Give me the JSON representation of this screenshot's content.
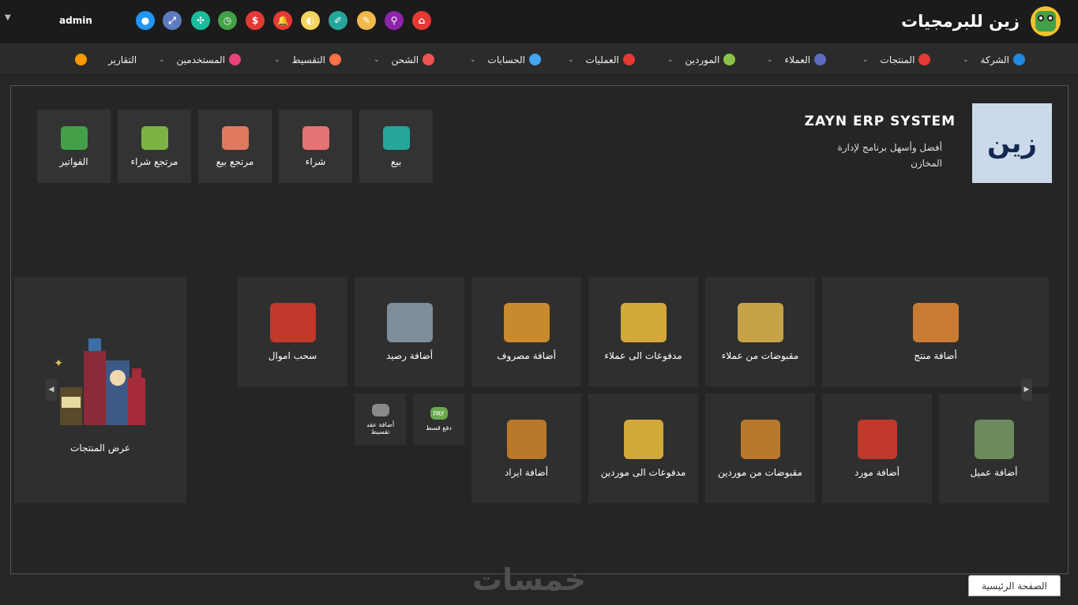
{
  "header": {
    "brand_name": "زين للبرمجيات",
    "user_name": "admin",
    "toolbar_icons": [
      {
        "name": "home-icon",
        "glyph": "⌂",
        "color": "#e53935"
      },
      {
        "name": "search-icon",
        "glyph": "⚲",
        "color": "#8e24aa"
      },
      {
        "name": "notes-icon",
        "glyph": "✎",
        "color": "#f0b94a"
      },
      {
        "name": "edit-icon",
        "glyph": "✐",
        "color": "#26a69a"
      },
      {
        "name": "theme-icon",
        "glyph": "◐",
        "color": "#f4d35e"
      },
      {
        "name": "bell-icon",
        "glyph": "🔔",
        "color": "#e53935"
      },
      {
        "name": "dollar-icon",
        "glyph": "$",
        "color": "#e53935"
      },
      {
        "name": "clock-icon",
        "glyph": "◷",
        "color": "#43a047"
      },
      {
        "name": "compress-icon",
        "glyph": "✣",
        "color": "#1abc9c"
      },
      {
        "name": "expand-icon",
        "glyph": "⤢",
        "color": "#5c7cbf"
      },
      {
        "name": "user-icon",
        "glyph": "●",
        "color": "#2196f3"
      }
    ]
  },
  "menu": {
    "items": [
      {
        "label": "الشركة",
        "icon": "company-icon",
        "color": "#1e88e5"
      },
      {
        "label": "المنتجات",
        "icon": "products-icon",
        "color": "#e53935"
      },
      {
        "label": "العملاء",
        "icon": "customers-icon",
        "color": "#5c6bc0"
      },
      {
        "label": "الموردين",
        "icon": "suppliers-icon",
        "color": "#8bc34a"
      },
      {
        "label": "العمليات",
        "icon": "operations-icon",
        "color": "#e53935"
      },
      {
        "label": "الحسابات",
        "icon": "accounts-icon",
        "color": "#42a5f5"
      },
      {
        "label": "الشحن",
        "icon": "shipping-icon",
        "color": "#ef5350"
      },
      {
        "label": "التقسيط",
        "icon": "installments-icon",
        "color": "#ff7043"
      },
      {
        "label": "المستخدمين",
        "icon": "users-icon",
        "color": "#ec407a"
      },
      {
        "label": "التقارير",
        "icon": "reports-icon",
        "color": "#ff9800"
      }
    ]
  },
  "system": {
    "logo_text": "زين",
    "title": "ZAYN ERP SYSTEM",
    "description": "أفضل وأسهل برنامج لإدارة المخازن"
  },
  "quick_tiles": [
    {
      "label": "بيع",
      "icon": "sales-chart-icon",
      "color": "#26a69a"
    },
    {
      "label": "شراء",
      "icon": "shopping-cart-icon",
      "color": "#e57373"
    },
    {
      "label": "مرتجع بيع",
      "icon": "sales-return-icon",
      "color": "#e07a5f"
    },
    {
      "label": "مرتجع شراء",
      "icon": "purchase-return-icon",
      "color": "#7cb342"
    },
    {
      "label": "الفواتير",
      "icon": "invoices-icon",
      "color": "#43a047"
    }
  ],
  "actions": {
    "row1": [
      {
        "label": "أضافة منتج",
        "icon": "add-product-icon",
        "color": "#c97b33"
      },
      {
        "label": "مقبوضات من عملاء",
        "icon": "customer-receipts-icon",
        "color": "#c5a348"
      },
      {
        "label": "مدفوعات الى عملاء",
        "icon": "customer-payments-icon",
        "color": "#d4a93b"
      },
      {
        "label": "أضافة مصروف",
        "icon": "add-expense-icon",
        "color": "#c98a2e"
      },
      {
        "label": "أضافة رصيد",
        "icon": "add-balance-icon",
        "color": "#7d8d9a"
      },
      {
        "label": "سحب اموال",
        "icon": "withdraw-cash-icon",
        "color": "#c0392b"
      }
    ],
    "row2": [
      {
        "label": "أضافة عميل",
        "icon": "add-customer-icon",
        "color": "#6d8a5c"
      },
      {
        "label": "أضافة مورد",
        "icon": "add-supplier-icon",
        "color": "#c0392b"
      },
      {
        "label": "مقبوضات من موردين",
        "icon": "supplier-receipts-icon",
        "color": "#b8792b"
      },
      {
        "label": "مدفوعات الى موردين",
        "icon": "supplier-payments-icon",
        "color": "#d4a93b"
      },
      {
        "label": "أضافة ايراد",
        "icon": "add-revenue-icon",
        "color": "#b8792b"
      }
    ],
    "small": [
      {
        "label": "دفع قسط",
        "icon": "pay-installment-icon",
        "color": "#6aa84f",
        "badge": "PAY"
      },
      {
        "label": "أضافة عقد تقسيط",
        "icon": "installment-contract-icon",
        "color": "#8a8a8a"
      }
    ]
  },
  "products_panel": {
    "label": "عرض المنتجات",
    "icon": "products-bottles-icon",
    "color": "#a52a3a"
  },
  "footer": {
    "watermark": "خمسات",
    "home_tab": "الصفحة الرئيسية"
  }
}
